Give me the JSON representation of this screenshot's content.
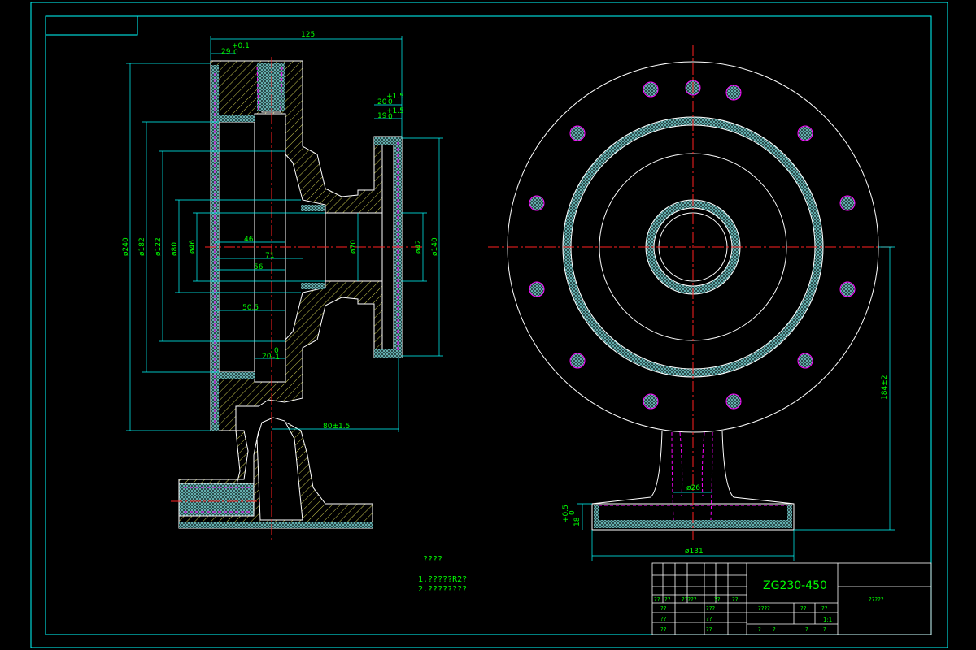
{
  "drawing": {
    "colors": {
      "frame": "#00ffff",
      "outline": "#ffffff",
      "dimension": "#00ffff",
      "text": "#00ff00",
      "center_line": "#ff2020",
      "hatch": "#c8c850",
      "hidden": "#ff00ff"
    },
    "section_view": {
      "dims": {
        "overall_length": "125",
        "flange_thk": "29",
        "flange_thk_tol": "+0.1",
        "flange_thk_tol_low": "0",
        "boss_a": "20",
        "boss_a_tol": "+1.5",
        "boss_a_tol_low": "0",
        "boss_b": "19",
        "boss_b_tol": "+1.5",
        "boss_b_tol_low": "0",
        "dia_240": "ø240",
        "dia_182": "ø182",
        "dia_122": "ø122",
        "dia_80": "ø80",
        "dia_46": "ø46",
        "dia_70": "ø70",
        "dia_42": "ø42",
        "dia_140": "ø140",
        "len_46": "46",
        "len_71": "71",
        "len_56": "56",
        "len_50_5": "50.5",
        "len_20": "20",
        "len_20_tol": "0",
        "len_20_tol_low": "-1",
        "len_80": "80±1.5"
      }
    },
    "front_view": {
      "dims": {
        "height": "184±2",
        "dia_26": "ø26",
        "base_thk": "18",
        "base_thk_tol": "+0.5",
        "base_thk_tol_low": "0",
        "base_dia": "ø131"
      }
    },
    "notes": {
      "heading": "????",
      "line1": "1.?????R2?",
      "line2": "2.????????"
    },
    "title_block": {
      "material": "ZG230-450",
      "drawing_name": "?????",
      "cells": {
        "r1a": "??",
        "r1b": "??",
        "r1c": "?????",
        "r1d": "??",
        "r1e": "??",
        "r2a": "??",
        "r2b": "???",
        "r3a": "??",
        "r3b": "??",
        "r4a": "??",
        "r4b": "??",
        "stage": "????",
        "weight": "??",
        "scale": "??",
        "scale_val": "1:1",
        "sheet_a": "?",
        "sheet_b": "?",
        "sheet_c": "?",
        "sheet_d": "?"
      }
    }
  }
}
